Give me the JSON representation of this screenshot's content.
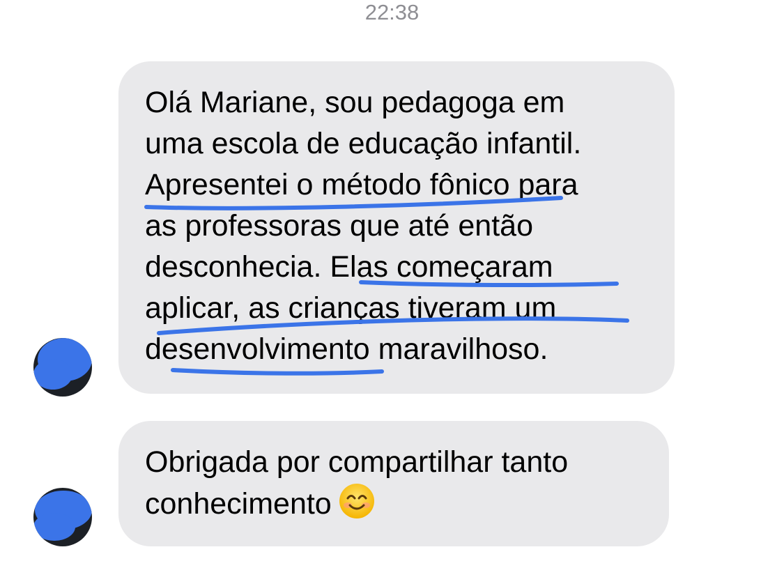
{
  "thread": {
    "timestamp": "22:38"
  },
  "messages": [
    {
      "lines": [
        "Olá Mariane, sou pedagoga em",
        "uma escola de educação infantil.",
        "Apresentei o método fônico para",
        "as professoras que até então",
        "desconhecia. Elas começaram",
        "aplicar, as crianças tiveram um",
        "desenvolvimento maravilhoso."
      ]
    },
    {
      "lines": [
        "Obrigada por compartilhar tanto",
        "conhecimento"
      ],
      "emoji": "smiling-face-with-smiling-eyes"
    }
  ],
  "colors": {
    "bubble_background": "#e9e9eb",
    "timestamp_text": "#8e8e93",
    "annotation_underline": "#3b74e8",
    "avatar_redaction": "#3b74e8"
  }
}
